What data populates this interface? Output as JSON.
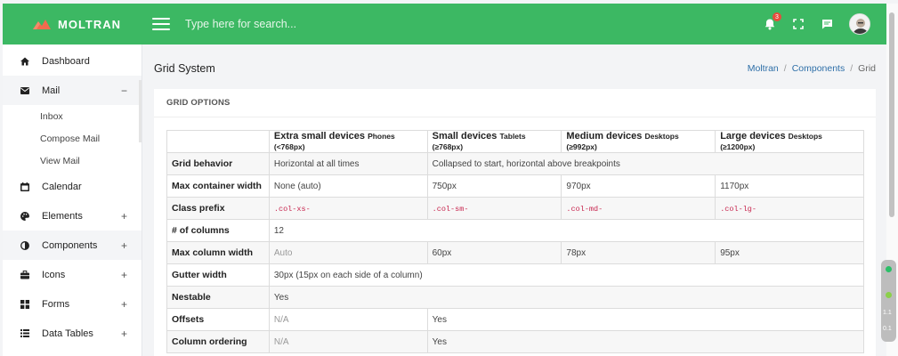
{
  "app": {
    "brand": "MOLTRAN"
  },
  "header": {
    "search_placeholder": "Type here for search...",
    "notification_count": "3"
  },
  "sidebar": {
    "items": [
      {
        "label": "Dashboard",
        "icon": "home-icon",
        "toggle": ""
      },
      {
        "label": "Mail",
        "icon": "envelope-icon",
        "toggle": "−"
      },
      {
        "label": "Calendar",
        "icon": "calendar-icon",
        "toggle": ""
      },
      {
        "label": "Elements",
        "icon": "palette-icon",
        "toggle": "+"
      },
      {
        "label": "Components",
        "icon": "half-circle-icon",
        "toggle": "+"
      },
      {
        "label": "Icons",
        "icon": "briefcase-icon",
        "toggle": "+"
      },
      {
        "label": "Forms",
        "icon": "grid-icon",
        "toggle": "+"
      },
      {
        "label": "Data Tables",
        "icon": "list-icon",
        "toggle": "+"
      }
    ],
    "mail_sub": [
      "Inbox",
      "Compose Mail",
      "View Mail"
    ]
  },
  "page": {
    "title": "Grid System",
    "breadcrumb": [
      "Moltran",
      "Components",
      "Grid"
    ],
    "card_title": "GRID OPTIONS"
  },
  "table": {
    "headers": [
      {
        "main": "Extra small devices",
        "sub": "Phones (<768px)"
      },
      {
        "main": "Small devices",
        "sub": "Tablets (≥768px)"
      },
      {
        "main": "Medium devices",
        "sub": "Desktops (≥992px)"
      },
      {
        "main": "Large devices",
        "sub": "Desktops (≥1200px)"
      }
    ],
    "rows": {
      "grid_behavior": {
        "label": "Grid behavior",
        "xs": "Horizontal at all times",
        "rest": "Collapsed to start, horizontal above breakpoints"
      },
      "max_container": {
        "label": "Max container width",
        "xs": "None (auto)",
        "sm": "750px",
        "md": "970px",
        "lg": "1170px"
      },
      "class_prefix": {
        "label": "Class prefix",
        "xs": ".col-xs-",
        "sm": ".col-sm-",
        "md": ".col-md-",
        "lg": ".col-lg-"
      },
      "columns": {
        "label": "# of columns",
        "value": "12"
      },
      "max_column": {
        "label": "Max column width",
        "xs": "Auto",
        "sm": "60px",
        "md": "78px",
        "lg": "95px"
      },
      "gutter": {
        "label": "Gutter width",
        "value": "30px (15px on each side of a column)"
      },
      "nestable": {
        "label": "Nestable",
        "value": "Yes"
      },
      "offsets": {
        "label": "Offsets",
        "xs": "N/A",
        "rest": "Yes"
      },
      "ordering": {
        "label": "Column ordering",
        "xs": "N/A",
        "rest": "Yes"
      }
    }
  },
  "widget": {
    "line1": "1.1",
    "line2": "0.1"
  },
  "colors": {
    "header": "#3cb863",
    "link": "#2e6fa8",
    "code": "#c7254e",
    "badge": "#e74c3c"
  }
}
